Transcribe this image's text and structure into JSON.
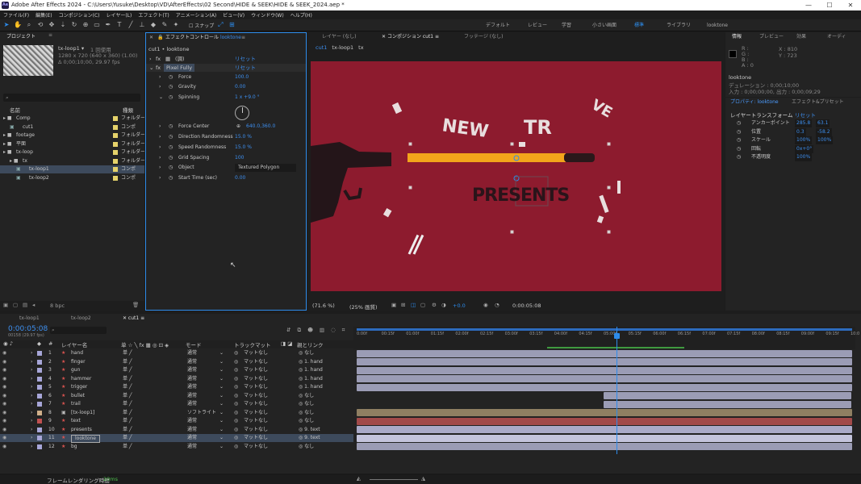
{
  "window": {
    "title": "Adobe After Effects 2024 - C:\\Users\\Yusuke\\Desktop\\VD\\AfterEffects\\02 Second\\HIDE & SEEK\\HIDE & SEEK_2024.aep *",
    "app_icon": "Ae"
  },
  "menu": [
    "ファイル(F)",
    "編集(E)",
    "コンポジション(C)",
    "レイヤー(L)",
    "エフェクト(T)",
    "アニメーション(A)",
    "ビュー(V)",
    "ウィンドウ(W)",
    "ヘルプ(H)"
  ],
  "toolbar": {
    "snap_label": "スナップ",
    "workspaces": [
      "デフォルト",
      "レビュー",
      "学習",
      "小さい画面",
      "標準",
      "ライブラリ",
      "looktone"
    ],
    "active_workspace": "標準"
  },
  "project": {
    "tab": "プロジェクト",
    "selected_name": "tx-loop1 ▾",
    "used_count": "1 回使用",
    "dims": "1280 x 720 (640 x 360) (1.00)",
    "duration": "Δ 0;00;10;00, 29.97 fps",
    "search_icon": "search-icon",
    "col_name": "名前",
    "col_type": "種類",
    "items": [
      {
        "name": "Comp",
        "type": "フォルダー",
        "color": "#e5d26a",
        "indent": 0
      },
      {
        "name": "cut1",
        "type": "コンポ",
        "color": "#e5d26a",
        "indent": 1
      },
      {
        "name": "footage",
        "type": "フォルダー",
        "color": "#e5d26a",
        "indent": 0
      },
      {
        "name": "平面",
        "type": "フォルダー",
        "color": "#e5d26a",
        "indent": 0
      },
      {
        "name": "tx-loop",
        "type": "フォルダー",
        "color": "#e5d26a",
        "indent": 0
      },
      {
        "name": "tx",
        "type": "フォルダー",
        "color": "#e5d26a",
        "indent": 1
      },
      {
        "name": "tx-loop1",
        "type": "コンポ",
        "color": "#e5d26a",
        "indent": 2,
        "selected": true
      },
      {
        "name": "tx-loop2",
        "type": "コンポ",
        "color": "#e5d26a",
        "indent": 2
      }
    ],
    "bpc": "8 bpc"
  },
  "effects": {
    "tab": "エフェクトコントロール",
    "layer": "looktone",
    "breadcrumb": "cut1 • looktone",
    "reset": "リセット",
    "fx1": "(調)",
    "fx_name": "Pixel Fully",
    "params": [
      {
        "label": "Force",
        "value": "100.0"
      },
      {
        "label": "Gravity",
        "value": "0.00"
      },
      {
        "label": "Spinning",
        "value": "1 x +9.0 °"
      },
      {
        "label": "Force Center",
        "value": "640.0,360.0"
      },
      {
        "label": "Direction Randomness",
        "value": "15.0 %"
      },
      {
        "label": "Speed Randomness",
        "value": "15.0 %"
      },
      {
        "label": "Grid Spacing",
        "value": "100"
      },
      {
        "label": "Object",
        "value": "Textured Polygon"
      },
      {
        "label": "Start Time (sec)",
        "value": "0.00"
      }
    ]
  },
  "viewer": {
    "tabs": [
      "レイヤー (なし)",
      "コンポジション cut1",
      "フッテージ (なし)"
    ],
    "crumbs": [
      "cut1",
      "tx-loop1",
      "tx"
    ],
    "zoom": "(71.6 %)",
    "res": "(25% 画質)",
    "exposure": "+0.0",
    "timecode": "0:00:05:08",
    "presents_text": "PRESENTS"
  },
  "info": {
    "tabs": [
      "情報",
      "プレビュー",
      "効果",
      "オーディ"
    ],
    "x": "X : 810",
    "y": "Y : 723",
    "r": "R :",
    "g": "G :",
    "b": "B :",
    "a": "A : 0",
    "layer": "looktone",
    "duration": "デュレーション : 0;00;10;00",
    "inout": "入力 : 0;00;00;00, 出力 : 0;00;09;29"
  },
  "properties": {
    "tabs": [
      "プロパティ: looktone",
      "エフェクト&プリセット"
    ],
    "header": "レイヤートランスフォーム",
    "reset": "リセット",
    "rows": [
      {
        "label": "アンカーポイント",
        "v1": "285.8",
        "v2": "63.1"
      },
      {
        "label": "位置",
        "v1": "0.3",
        "v2": "-58.2"
      },
      {
        "label": "スケール",
        "v1": "100%",
        "v2": "100%"
      },
      {
        "label": "回転",
        "v1": "0x+0°",
        "v2": ""
      },
      {
        "label": "不透明度",
        "v1": "100%",
        "v2": ""
      }
    ]
  },
  "timeline": {
    "tabs": [
      "tx-loop1",
      "tx-loop2",
      "cut1"
    ],
    "timecode": "0:00:05:08",
    "subtime": "00158 (29.97 fps)",
    "col_layer": "レイヤー名",
    "col_mode": "モード",
    "col_track": "トラックマット",
    "col_parent": "親とリンク",
    "ruler": [
      "0:00f",
      "00:15f",
      "01:00f",
      "01:15f",
      "02:00f",
      "02:15f",
      "03:00f",
      "03:15f",
      "04:00f",
      "04:15f",
      "05:00f",
      "05:15f",
      "06:00f",
      "06:15f",
      "07:00f",
      "07:15f",
      "08:00f",
      "08:15f",
      "09:00f",
      "09:15f",
      "10:0"
    ],
    "playhead_frac": 0.526,
    "layers": [
      {
        "num": "1",
        "name": "hand",
        "color": "#a7a6d8",
        "mode": "通常",
        "track": "マットなし",
        "parent": "なし",
        "start": 0,
        "end": 1,
        "bar": "#9b9cb5"
      },
      {
        "num": "2",
        "name": "finger",
        "color": "#a7a6d8",
        "mode": "通常",
        "track": "マットなし",
        "parent": "1. hand",
        "start": 0,
        "end": 1,
        "bar": "#9b9cb5"
      },
      {
        "num": "3",
        "name": "gun",
        "color": "#a7a6d8",
        "mode": "通常",
        "track": "マットなし",
        "parent": "1. hand",
        "start": 0,
        "end": 1,
        "bar": "#9b9cb5"
      },
      {
        "num": "4",
        "name": "hammer",
        "color": "#a7a6d8",
        "mode": "通常",
        "track": "マットなし",
        "parent": "1. hand",
        "start": 0,
        "end": 1,
        "bar": "#9b9cb5"
      },
      {
        "num": "5",
        "name": "trigger",
        "color": "#a7a6d8",
        "mode": "通常",
        "track": "マットなし",
        "parent": "1. hand",
        "start": 0,
        "end": 1,
        "bar": "#9b9cb5"
      },
      {
        "num": "6",
        "name": "bullet",
        "color": "#a7a6d8",
        "mode": "通常",
        "track": "マットなし",
        "parent": "なし",
        "start": 0.5,
        "end": 1,
        "bar": "#9b9cb5"
      },
      {
        "num": "7",
        "name": "trail",
        "color": "#a7a6d8",
        "mode": "通常",
        "track": "マットなし",
        "parent": "なし",
        "start": 0.5,
        "end": 1,
        "bar": "#9b9cb5"
      },
      {
        "num": "8",
        "name": "[tx-loop1]",
        "color": "#d0b08a",
        "mode": "ソフトライト",
        "track": "マットなし",
        "parent": "なし",
        "start": 0,
        "end": 1,
        "bar": "#8f7f62"
      },
      {
        "num": "9",
        "name": "text",
        "color": "#c05050",
        "mode": "通常",
        "track": "マットなし",
        "parent": "なし",
        "start": 0,
        "end": 1,
        "bar": "#a24a4a"
      },
      {
        "num": "10",
        "name": "presents",
        "color": "#a7a6d8",
        "mode": "通常",
        "track": "マットなし",
        "parent": "9. text",
        "start": 0,
        "end": 1,
        "bar": "#aaaac8"
      },
      {
        "num": "11",
        "name": "looktone",
        "color": "#a7a6d8",
        "mode": "通常",
        "track": "マットなし",
        "parent": "9. text",
        "start": 0,
        "end": 1,
        "bar": "#c4c4dc",
        "selected": true
      },
      {
        "num": "12",
        "name": "bg",
        "color": "#a7a6d8",
        "mode": "通常",
        "track": "マットなし",
        "parent": "なし",
        "start": 0,
        "end": 1,
        "bar": "#9b9cb5"
      }
    ],
    "render_time_label": "フレームレンダリング時間",
    "render_time": "20ms"
  }
}
